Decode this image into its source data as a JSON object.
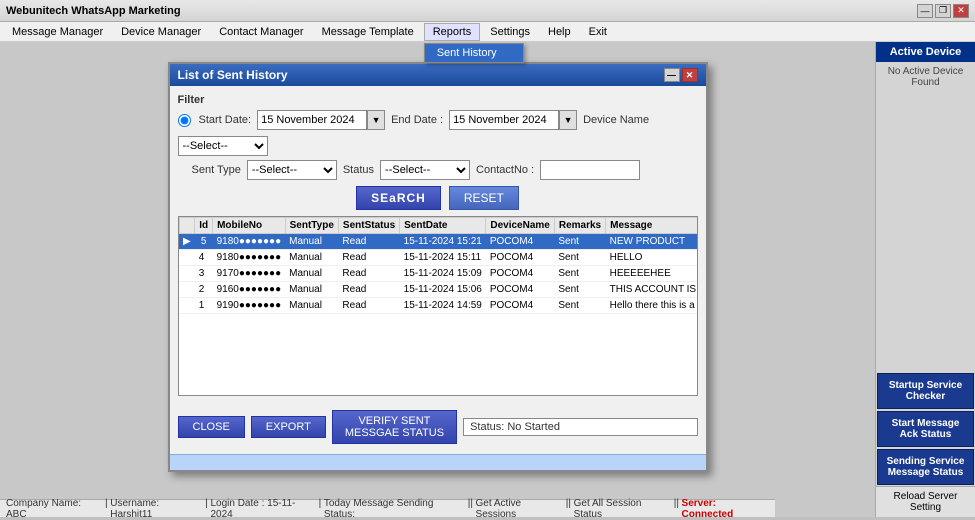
{
  "app": {
    "title": "Webunitech WhatsApp Marketing",
    "title_icon": "whatsapp-icon"
  },
  "title_bar_controls": {
    "minimize": "—",
    "restore": "❐",
    "close": "✕"
  },
  "menu": {
    "items": [
      {
        "label": "Message Manager",
        "id": "message-manager"
      },
      {
        "label": "Device Manager",
        "id": "device-manager"
      },
      {
        "label": "Contact Manager",
        "id": "contact-manager"
      },
      {
        "label": "Message Template",
        "id": "message-template"
      },
      {
        "label": "Reports",
        "id": "reports",
        "active": true
      },
      {
        "label": "Settings",
        "id": "settings"
      },
      {
        "label": "Help",
        "id": "help"
      },
      {
        "label": "Exit",
        "id": "exit"
      }
    ],
    "reports_dropdown": [
      {
        "label": "Sent History",
        "id": "sent-history"
      }
    ]
  },
  "modal": {
    "title": "List of Sent History",
    "close_btn": "✕",
    "filter": {
      "label": "Filter",
      "start_date_label": "Start Date:",
      "start_date_value": "15 November 2024",
      "end_date_label": "End Date :",
      "end_date_value": "15 November 2024",
      "device_name_label": "Device Name",
      "device_name_value": "--Select--",
      "sent_type_label": "Sent Type",
      "sent_type_value": "--Select--",
      "status_label": "Status",
      "status_value": "--Select--",
      "contact_no_label": "ContactNo :",
      "contact_no_value": ""
    },
    "buttons": {
      "search": "SEaRCH",
      "reset": "RESET"
    },
    "table": {
      "columns": [
        "Id",
        "MobileNo",
        "SentType",
        "SentStatus",
        "SentDate",
        "DeviceName",
        "Remarks",
        "Message"
      ],
      "rows": [
        {
          "id": "5",
          "mobile": "91800000000",
          "sent_type": "Manual",
          "sent_status": "Read",
          "sent_date": "15-11-2024 15:21",
          "device": "POCOM4",
          "remarks": "Sent",
          "message": "NEW PRODUCT",
          "selected": true
        },
        {
          "id": "4",
          "mobile": "918000000000",
          "sent_type": "Manual",
          "sent_status": "Read",
          "sent_date": "15-11-2024 15:11",
          "device": "POCOM4",
          "remarks": "Sent",
          "message": "HELLO"
        },
        {
          "id": "3",
          "mobile": "917000000000",
          "sent_type": "Manual",
          "sent_status": "Read",
          "sent_date": "15-11-2024 15:09",
          "device": "POCOM4",
          "remarks": "Sent",
          "message": "HEEEEEHEE"
        },
        {
          "id": "2",
          "mobile": "916000000000",
          "sent_type": "Manual",
          "sent_status": "Read",
          "sent_date": "15-11-2024 15:06",
          "device": "POCOM4",
          "remarks": "Sent",
          "message": "THIS ACCOUNT IS BEING INVADED"
        },
        {
          "id": "1",
          "mobile": "919000000000",
          "sent_type": "Manual",
          "sent_status": "Read",
          "sent_date": "15-11-2024 14:59",
          "device": "POCOM4",
          "remarks": "Sent",
          "message": "Hello there this is a message from WS WhatsA"
        }
      ]
    },
    "footer": {
      "close_btn": "CLOSE",
      "export_btn": "EXPORT",
      "verify_btn": "VERIFY SENT\nMESSGAE STATUS",
      "status_label": "Status: No Started"
    },
    "bottom_bar": ""
  },
  "right_sidebar": {
    "title": "Active Device",
    "info": "No Active Device Found",
    "buttons": [
      {
        "label": "Startup Service Checker",
        "id": "startup-service-checker"
      },
      {
        "label": "Start Message Ack Status",
        "id": "start-message-ack"
      },
      {
        "label": "Sending Service Message Status",
        "id": "sending-service-status"
      }
    ],
    "reload_btn": "Reload Server Setting"
  },
  "status_bar": {
    "company": "Company Name: ABC",
    "username": "Username: Harshit11",
    "login_date": "Login Date : 15-11-2024",
    "msg_status": "Today Message Sending Status:",
    "active_sessions": "Get Active Sessions",
    "all_sessions": "Get All Session Status",
    "server_status": "Server: Connected",
    "dividers": "||"
  }
}
